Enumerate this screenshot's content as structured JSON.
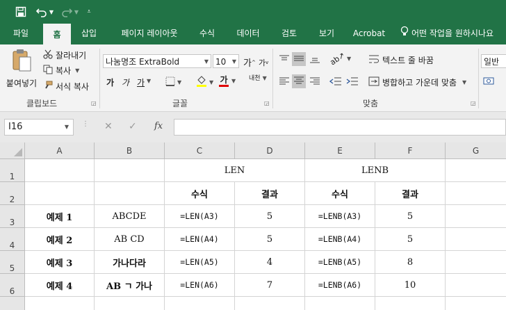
{
  "quick_access": {
    "save_icon": "save-icon",
    "undo_icon": "undo-icon",
    "redo_icon": "redo-icon",
    "customize_icon": "customize-icon"
  },
  "tabs": [
    {
      "label": "파일"
    },
    {
      "label": "홈"
    },
    {
      "label": "삽입"
    },
    {
      "label": "페이지 레이아웃"
    },
    {
      "label": "수식"
    },
    {
      "label": "데이터"
    },
    {
      "label": "검토"
    },
    {
      "label": "보기"
    },
    {
      "label": "Acrobat"
    }
  ],
  "tell_me": "어떤 작업을 원하시나요",
  "ribbon": {
    "paste_label": "붙여넣기",
    "cut_label": "잘라내기",
    "copy_label": "복사",
    "format_painter_label": "서식 복사",
    "clipboard_group": "클립보드",
    "font_name": "나눔명조 ExtraBold",
    "font_size": "10",
    "bold_glyph": "가",
    "italic_glyph": "가",
    "underline_glyph": "가",
    "font_color_glyph": "가",
    "grow_font_glyph": "가",
    "shrink_font_glyph": "가",
    "phonetic_glyph": "내천",
    "font_group": "글꼴",
    "wrap_text_label": "텍스트 줄 바꿈",
    "merge_center_label": "병합하고 가운데 맞춤",
    "alignment_group": "맞춤",
    "number_format": "일반"
  },
  "formula_bar": {
    "name_box": "I16",
    "cancel": "✕",
    "enter": "✓",
    "fx": "fx",
    "formula": ""
  },
  "columns": [
    "A",
    "B",
    "C",
    "D",
    "E",
    "F",
    "G"
  ],
  "rows": [
    "1",
    "2",
    "3",
    "4",
    "5",
    "6"
  ],
  "sheet": {
    "header_len": "LEN",
    "header_lenb": "LENB",
    "sub_formula_1": "수식",
    "sub_result_1": "결과",
    "sub_formula_2": "수식",
    "sub_result_2": "결과",
    "data": [
      {
        "label": "예제 1",
        "text": "ABCDE",
        "len_formula": "=LEN(A3)",
        "len_result": "5",
        "lenb_formula": "=LENB(A3)",
        "lenb_result": "5"
      },
      {
        "label": "예제 2",
        "text": "AB CD",
        "len_formula": "=LEN(A4)",
        "len_result": "5",
        "lenb_formula": "=LENB(A4)",
        "lenb_result": "5"
      },
      {
        "label": "예제 3",
        "text": "가나다라",
        "len_formula": "=LEN(A5)",
        "len_result": "4",
        "lenb_formula": "=LENB(A5)",
        "lenb_result": "8"
      },
      {
        "label": "예제 4",
        "text": "AB ㄱ 가나",
        "len_formula": "=LEN(A6)",
        "len_result": "7",
        "lenb_formula": "=LENB(A6)",
        "lenb_result": "10"
      }
    ]
  }
}
